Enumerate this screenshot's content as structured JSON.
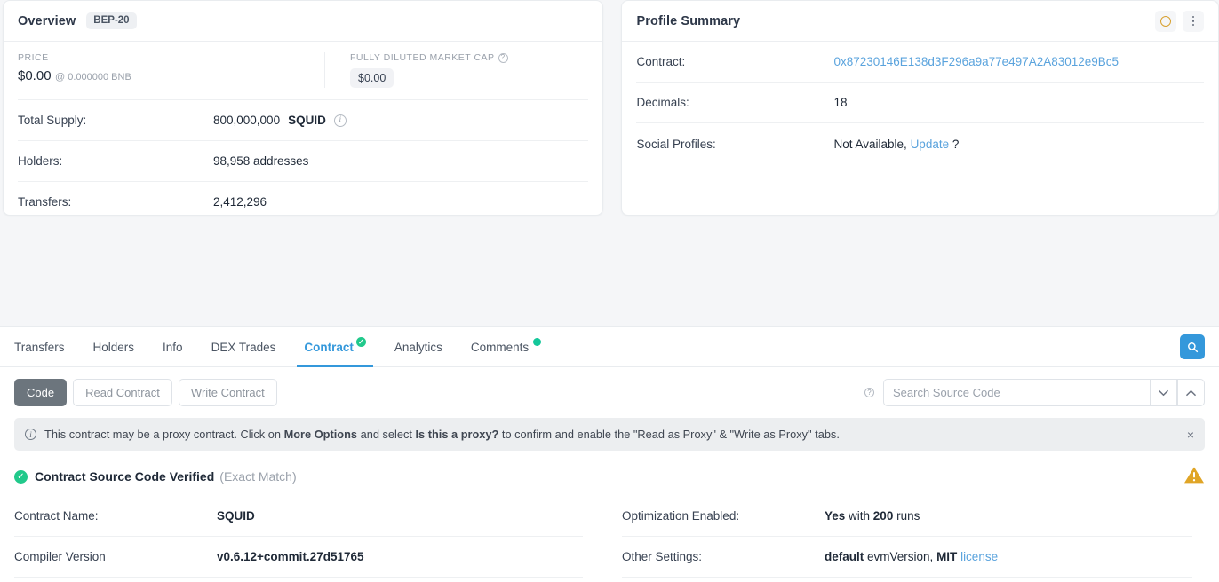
{
  "overview": {
    "title": "Overview",
    "badge": "BEP-20",
    "price_kicker": "PRICE",
    "price_main": "$0.00",
    "price_sub": "@ 0.000000 BNB",
    "fdv_kicker": "FULLY DILUTED MARKET CAP",
    "fdv_value": "$0.00",
    "rows": [
      {
        "label": "Total Supply:",
        "value": "800,000,000",
        "symbol": "SQUID",
        "info": true
      },
      {
        "label": "Holders:",
        "value": "98,958 addresses",
        "symbol": "",
        "info": false
      },
      {
        "label": "Transfers:",
        "value": "2,412,296",
        "symbol": "",
        "info": false
      }
    ]
  },
  "profile": {
    "title": "Profile Summary",
    "rows": [
      {
        "label": "Contract:",
        "value": "0x87230146E138d3F296a9a77e497A2A83012e9Bc5"
      },
      {
        "label": "Decimals:",
        "value": "18"
      },
      {
        "label": "Social Profiles:",
        "value": "Not Available,",
        "link": "Update",
        "suffix": "?"
      }
    ]
  },
  "tabs": [
    {
      "label": "Transfers",
      "active": false
    },
    {
      "label": "Holders",
      "active": false
    },
    {
      "label": "Info",
      "active": false
    },
    {
      "label": "DEX Trades",
      "active": false
    },
    {
      "label": "Contract",
      "active": true
    },
    {
      "label": "Analytics",
      "active": false
    },
    {
      "label": "Comments",
      "active": false
    }
  ],
  "contract_controls": {
    "buttons": [
      {
        "label": "Code",
        "active": true
      },
      {
        "label": "Read Contract",
        "active": false
      },
      {
        "label": "Write Contract",
        "active": false
      }
    ],
    "search_placeholder": "Search Source Code",
    "search_value": ""
  },
  "notice": {
    "text_1": "This contract may be a proxy contract. Click on ",
    "bold_1": "More Options",
    "text_2": " and select ",
    "bold_2": "Is this a proxy?",
    "text_3": " to confirm and enable the \"Read as Proxy\" & \"Write as Proxy\" tabs.",
    "close": "×"
  },
  "verified": {
    "title": "Contract Source Code Verified",
    "subtitle": "(Exact Match)"
  },
  "details": {
    "left": [
      {
        "label": "Contract Name:",
        "value": "SQUID"
      },
      {
        "label": "Compiler Version",
        "value": "v0.6.12+commit.27d51765"
      }
    ],
    "right": [
      {
        "label": "Optimization Enabled:",
        "bold_1": "Yes",
        "mid": " with ",
        "bold_2": "200",
        "tail": " runs"
      },
      {
        "label": "Other Settings:",
        "bold_1": "default",
        "mid": " evmVersion, ",
        "bold_2": "MIT",
        "tail": " license"
      }
    ]
  },
  "colors": {
    "accent_blue": "#3498db",
    "link_blue": "#5aa3dd",
    "green": "#21c98b",
    "warning": "#e0a526",
    "active_btn": "#6c757d"
  }
}
